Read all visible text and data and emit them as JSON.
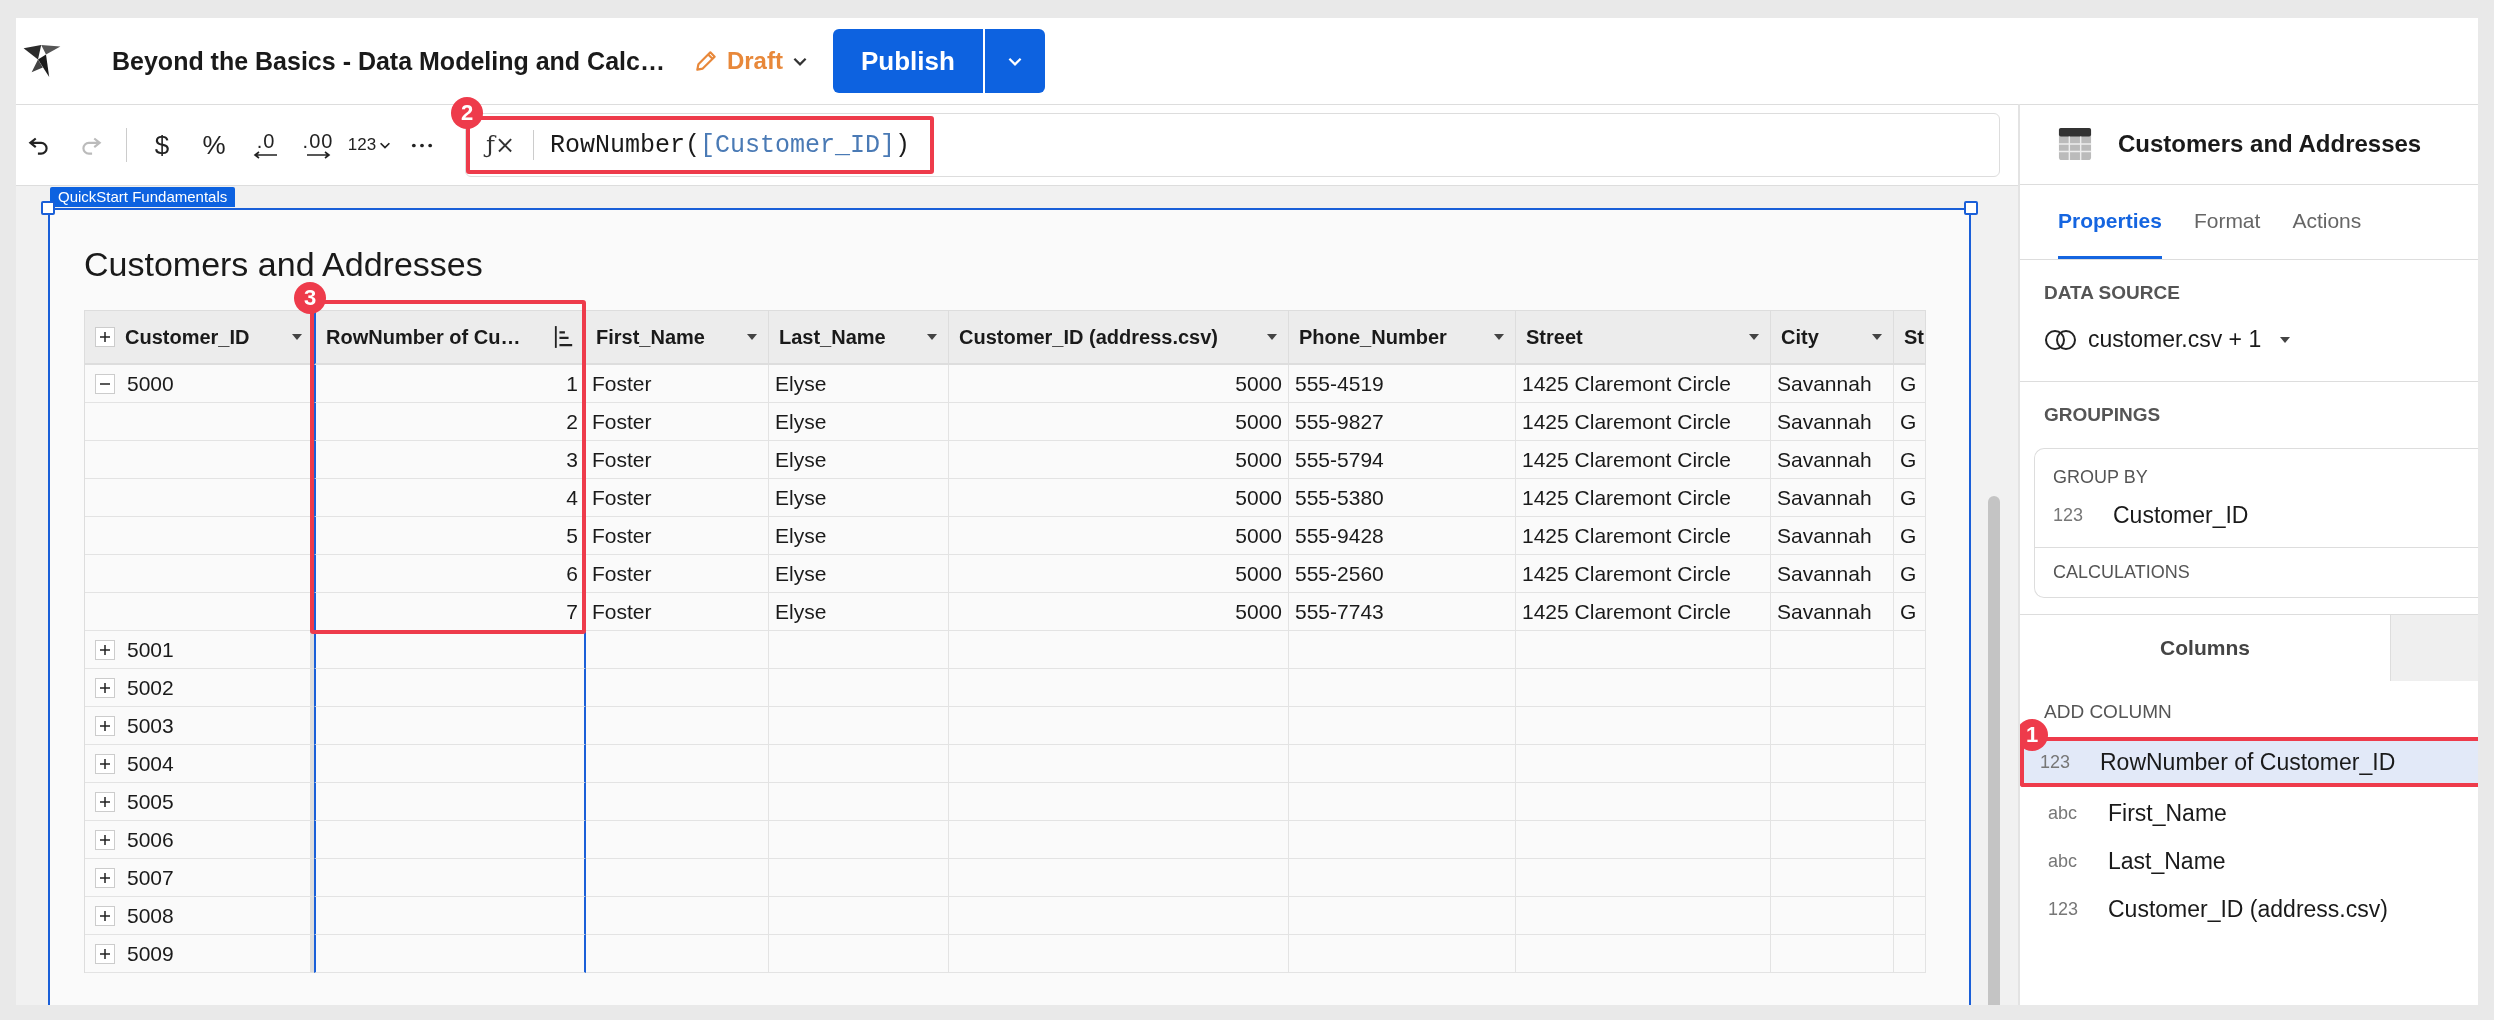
{
  "header": {
    "title": "Beyond the Basics - Data Modeling and Calc…",
    "status": "Draft",
    "publish": "Publish"
  },
  "toolbar": [
    {
      "kind": "undo",
      "disabled": false
    },
    {
      "kind": "redo",
      "disabled": true
    },
    {
      "kind": "symbol",
      "label": "$",
      "disabled": false
    },
    {
      "kind": "symbol",
      "label": "%",
      "disabled": false
    },
    {
      "kind": "decrease",
      "label": ".0",
      "disabled": false
    },
    {
      "kind": "increase",
      "label": ".00",
      "disabled": false
    },
    {
      "kind": "menu",
      "label": "123",
      "disabled": false
    },
    {
      "kind": "more",
      "disabled": false
    }
  ],
  "formula": {
    "symbol": "ƒ×",
    "function": "RowNumber(",
    "argument": "[Customer_ID]",
    "close": ")",
    "callout": "2"
  },
  "canvas": {
    "tag": "QuickStart Fundamentals"
  },
  "table": {
    "title": "Customers and Addresses",
    "callout": "3",
    "columns": [
      {
        "label": "Customer_ID",
        "kind": "dropdown",
        "numeric": false,
        "selected": false
      },
      {
        "label": "RowNumber of Cu…",
        "kind": "sort",
        "numeric": true,
        "selected": true
      },
      {
        "label": "First_Name",
        "kind": "dropdown",
        "numeric": false,
        "selected": false
      },
      {
        "label": "Last_Name",
        "kind": "dropdown",
        "numeric": false,
        "selected": false
      },
      {
        "label": "Customer_ID (address.csv)",
        "kind": "dropdown",
        "numeric": true,
        "selected": false
      },
      {
        "label": "Phone_Number",
        "kind": "dropdown",
        "numeric": false,
        "selected": false
      },
      {
        "label": "Street",
        "kind": "dropdown",
        "numeric": false,
        "selected": false
      },
      {
        "label": "City",
        "kind": "dropdown",
        "numeric": false,
        "selected": false
      },
      {
        "label": "St",
        "kind": "plain",
        "numeric": false,
        "selected": false
      }
    ],
    "groups": [
      {
        "key": "5000",
        "expanded": true,
        "rows": [
          [
            "1",
            "Foster",
            "Elyse",
            "5000",
            "555-4519",
            "1425 Claremont Circle",
            "Savannah",
            "G"
          ],
          [
            "2",
            "Foster",
            "Elyse",
            "5000",
            "555-9827",
            "1425 Claremont Circle",
            "Savannah",
            "G"
          ],
          [
            "3",
            "Foster",
            "Elyse",
            "5000",
            "555-5794",
            "1425 Claremont Circle",
            "Savannah",
            "G"
          ],
          [
            "4",
            "Foster",
            "Elyse",
            "5000",
            "555-5380",
            "1425 Claremont Circle",
            "Savannah",
            "G"
          ],
          [
            "5",
            "Foster",
            "Elyse",
            "5000",
            "555-9428",
            "1425 Claremont Circle",
            "Savannah",
            "G"
          ],
          [
            "6",
            "Foster",
            "Elyse",
            "5000",
            "555-2560",
            "1425 Claremont Circle",
            "Savannah",
            "G"
          ],
          [
            "7",
            "Foster",
            "Elyse",
            "5000",
            "555-7743",
            "1425 Claremont Circle",
            "Savannah",
            "G"
          ]
        ]
      },
      {
        "key": "5001",
        "expanded": false
      },
      {
        "key": "5002",
        "expanded": false
      },
      {
        "key": "5003",
        "expanded": false
      },
      {
        "key": "5004",
        "expanded": false
      },
      {
        "key": "5005",
        "expanded": false
      },
      {
        "key": "5006",
        "expanded": false
      },
      {
        "key": "5007",
        "expanded": false
      },
      {
        "key": "5008",
        "expanded": false
      },
      {
        "key": "5009",
        "expanded": false
      }
    ]
  },
  "panel": {
    "title": "Customers and Addresses",
    "tabs": [
      {
        "label": "Properties",
        "selected": true
      },
      {
        "label": "Format",
        "selected": false
      },
      {
        "label": "Actions",
        "selected": false
      }
    ],
    "data_source": {
      "heading": "DATA SOURCE",
      "value": "customer.csv + 1"
    },
    "groupings": {
      "heading": "GROUPINGS",
      "group_by_heading": "GROUP BY",
      "group_by": [
        {
          "type": "123",
          "name": "Customer_ID"
        }
      ],
      "calculations_heading": "CALCULATIONS"
    },
    "columns_tab": "Columns",
    "add_column_heading": "ADD COLUMN",
    "columns": [
      {
        "type": "123",
        "name": "RowNumber of Customer_ID",
        "selected": true,
        "callout": "1"
      },
      {
        "type": "abc",
        "name": "First_Name",
        "selected": false
      },
      {
        "type": "abc",
        "name": "Last_Name",
        "selected": false
      },
      {
        "type": "123",
        "name": "Customer_ID (address.csv)",
        "selected": false
      }
    ]
  }
}
